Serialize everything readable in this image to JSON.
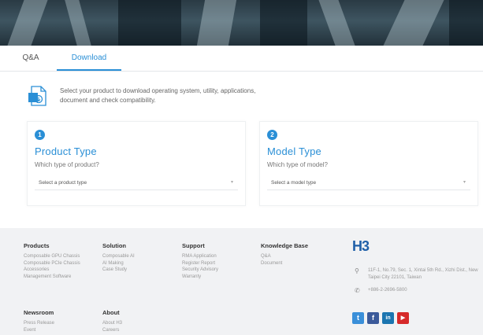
{
  "tabs": [
    {
      "label": "Q&A",
      "active": false
    },
    {
      "label": "Download",
      "active": true
    }
  ],
  "intro": {
    "icon": "download-document-icon",
    "text": "Select your product to download operating system, utility, applications, document and check compatibility."
  },
  "selectors": [
    {
      "step": "1",
      "title": "Product Type",
      "subtitle": "Which type of product?",
      "placeholder": "Select a product type"
    },
    {
      "step": "2",
      "title": "Model Type",
      "subtitle": "Which type of model?",
      "placeholder": "Select a model type"
    }
  ],
  "footer": {
    "columns": [
      {
        "title": "Products",
        "items": [
          "Composable GPU Chassis",
          "Composable PCIe Chassis",
          "Accessories",
          "Management Software"
        ]
      },
      {
        "title": "Solution",
        "items": [
          "Composable AI",
          "AI Making",
          "Case Study"
        ]
      },
      {
        "title": "Support",
        "items": [
          "RMA Application",
          "Register Report",
          "Security Advisory",
          "Warranty"
        ]
      },
      {
        "title": "Knowledge Base",
        "items": [
          "Q&A",
          "Document"
        ]
      },
      {
        "title": "Newsroom",
        "items": [
          "Press Release",
          "Event"
        ]
      },
      {
        "title": "About",
        "items": [
          "About H3",
          "Careers"
        ]
      }
    ],
    "logo": "H3",
    "address": "11F-1, No.79, Sec. 1, Xintai 5th Rd., Xizhi Dist., New Taipei City 22101, Taiwan",
    "phone": "+886-2-2696-5800",
    "social": [
      {
        "name": "twitter",
        "glyph": "t",
        "color": "#3a8fd9"
      },
      {
        "name": "facebook",
        "glyph": "f",
        "color": "#3b5a9a"
      },
      {
        "name": "linkedin",
        "glyph": "in",
        "color": "#1b75b0"
      },
      {
        "name": "youtube",
        "glyph": "▶",
        "color": "#d62a2a"
      }
    ]
  },
  "colors": {
    "accent": "#2a8fd6",
    "footer_bg": "#f1f2f4",
    "logo": "#1f5fa8"
  }
}
